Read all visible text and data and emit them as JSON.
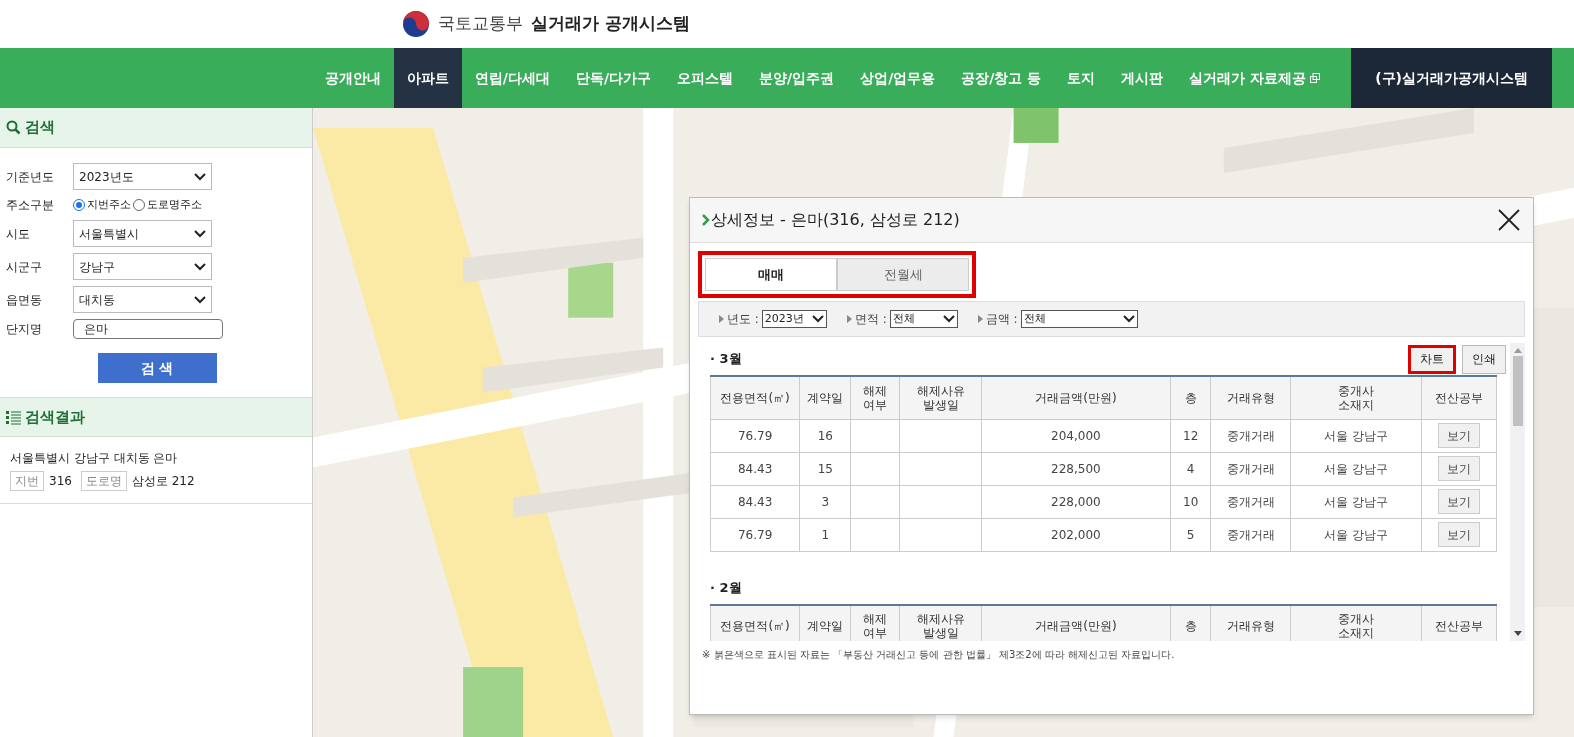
{
  "header": {
    "ministry": "국토교통부",
    "system": "실거래가 공개시스템"
  },
  "nav": [
    {
      "label": "공개안내",
      "selected": false,
      "kind": "link"
    },
    {
      "label": "아파트",
      "selected": true,
      "kind": "link"
    },
    {
      "label": "연립/다세대",
      "selected": false,
      "kind": "link"
    },
    {
      "label": "단독/다가구",
      "selected": false,
      "kind": "link"
    },
    {
      "label": "오피스텔",
      "selected": false,
      "kind": "link"
    },
    {
      "label": "분양/입주권",
      "selected": false,
      "kind": "link"
    },
    {
      "label": "상업/업무용",
      "selected": false,
      "kind": "link"
    },
    {
      "label": "공장/창고 등",
      "selected": false,
      "kind": "link"
    },
    {
      "label": "토지",
      "selected": false,
      "kind": "link"
    },
    {
      "label": "게시판",
      "selected": false,
      "kind": "link"
    },
    {
      "label": "실거래가 자료제공",
      "selected": false,
      "kind": "external"
    },
    {
      "label": "(구)실거래가공개시스템",
      "selected": false,
      "kind": "legacy"
    }
  ],
  "search": {
    "title": "검색",
    "fields": [
      {
        "kind": "select",
        "label": "기준년도",
        "value": "2023년도"
      },
      {
        "kind": "radio",
        "label": "주소구분",
        "options": [
          {
            "label": "지번주소",
            "selected": true
          },
          {
            "label": "도로명주소",
            "selected": false
          }
        ]
      },
      {
        "kind": "select",
        "label": "시도",
        "value": "서울특별시"
      },
      {
        "kind": "select",
        "label": "시군구",
        "value": "강남구"
      },
      {
        "kind": "select",
        "label": "읍면동",
        "value": "대치동"
      },
      {
        "kind": "input",
        "label": "단지명",
        "value": "은마"
      }
    ],
    "button": "검 색"
  },
  "results": {
    "title": "검색결과",
    "items": [
      {
        "name": "서울특별시 강남구 대치동 은마",
        "jibun_tag": "지번",
        "jibun": "316",
        "road_tag": "도로명",
        "road": "삼성로 212"
      }
    ]
  },
  "detail": {
    "title": "상세정보 - 은마(316, 삼성로 212)",
    "tabs_highlighted": true,
    "tabs": [
      {
        "label": "매매",
        "selected": true
      },
      {
        "label": "전월세",
        "selected": false
      }
    ],
    "filters": [
      {
        "label": "년도 :",
        "value": "2023년"
      },
      {
        "label": "면적 :",
        "value": "전체"
      },
      {
        "label": "금액 :",
        "value": "전체"
      }
    ],
    "actions": [
      {
        "label": "차트",
        "highlighted": true
      },
      {
        "label": "인쇄",
        "highlighted": false
      }
    ],
    "months": [
      {
        "label": "· 3월",
        "columns": [
          "전용면적(㎡)",
          "계약일",
          "해제\n여부",
          "해제사유\n발생일",
          "거래금액(만원)",
          "층",
          "거래유형",
          "중개사\n소재지",
          "전산공부"
        ],
        "rows": [
          [
            "76.79",
            "16",
            "",
            "",
            "204,000",
            "12",
            "중개거래",
            "서울 강남구",
            "보기"
          ],
          [
            "84.43",
            "15",
            "",
            "",
            "228,500",
            "4",
            "중개거래",
            "서울 강남구",
            "보기"
          ],
          [
            "84.43",
            "3",
            "",
            "",
            "228,000",
            "10",
            "중개거래",
            "서울 강남구",
            "보기"
          ],
          [
            "76.79",
            "1",
            "",
            "",
            "202,000",
            "5",
            "중개거래",
            "서울 강남구",
            "보기"
          ]
        ]
      },
      {
        "label": "· 2월",
        "columns": [
          "전용면적(㎡)",
          "계약일",
          "해제\n여부",
          "해제사유\n발생일",
          "거래금액(만원)",
          "층",
          "거래유형",
          "중개사\n소재지",
          "전산공부"
        ]
      }
    ],
    "note": "※ 붉은색으로 표시된 자료는 「부동산 거래신고 등에 관한 법률」 제3조2에 따라 해제신고된 자료입니다."
  }
}
